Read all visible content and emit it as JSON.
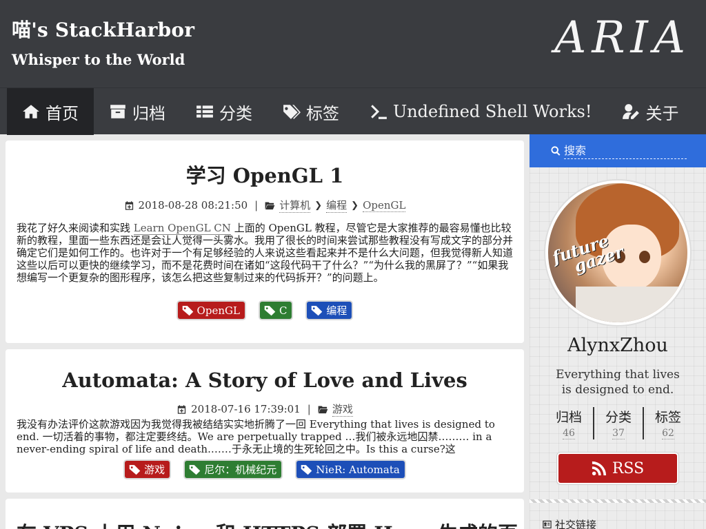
{
  "header": {
    "site_title": "喵's StackHarbor",
    "site_subtitle": "Whisper to the World",
    "logo_text": "ARIA"
  },
  "nav": {
    "items": [
      {
        "label": "首页",
        "icon": "home-icon"
      },
      {
        "label": "归档",
        "icon": "archive-icon"
      },
      {
        "label": "分类",
        "icon": "list-icon"
      },
      {
        "label": "标签",
        "icon": "tags-icon"
      },
      {
        "label": "Undefined Shell Works!",
        "icon": "terminal-icon"
      },
      {
        "label": "关于",
        "icon": "user-edit-icon"
      }
    ]
  },
  "posts": [
    {
      "title": "学习 OpenGL 1",
      "date": "2018-08-28 08:21:50",
      "categories": [
        "计算机",
        "编程",
        "OpenGL"
      ],
      "body_pre": "我花了好久来阅读和实践 ",
      "body_link": "Learn OpenGL CN",
      "body_post": " 上面的 OpenGL 教程，尽管它是大家推荐的最容易懂也比较新的教程，里面一些东西还是会让人觉得一头雾水。我用了很长的时间来尝试那些教程没有写成文字的部分并确定它们是如何工作的。也许对于一个有足够经验的人来说这些看起来并不是什么大问题，但我觉得新人知道这些以后可以更快的继续学习，而不是花费时间在诸如“这段代码干了什么？”“为什么我的黑屏了？”“如果我想编写一个更复杂的图形程序，该怎么把这些复制过来的代码拆开？”的问题上。",
      "tags": [
        {
          "label": "OpenGL",
          "color": "red"
        },
        {
          "label": "C",
          "color": "green"
        },
        {
          "label": "编程",
          "color": "blue"
        }
      ]
    },
    {
      "title": "Automata: A Story of Love and Lives",
      "date": "2018-07-16 17:39:01",
      "categories": [
        "游戏"
      ],
      "body": "我没有办法评价这款游戏因为我觉得我被结结实实地折腾了一回 Everything that lives is designed to end. 一切活着的事物，都注定要终结。We are perpetually trapped …我们被永远地囚禁……… in a never-ending spiral of life and death.……于永无止境的生死轮回之中。Is this a curse?这",
      "tags": [
        {
          "label": "游戏",
          "color": "red"
        },
        {
          "label": "尼尔：机械纪元",
          "color": "green"
        },
        {
          "label": "NieR: Automata",
          "color": "blue"
        }
      ]
    },
    {
      "title": "在 VPS 上用 Nginx 和 HTTPS 部署 Hexo 生成的页"
    }
  ],
  "sidebar": {
    "search_placeholder": "搜索",
    "avatar_text_1": "future",
    "avatar_text_2": "gazer",
    "author": "AlynxZhou",
    "motto": "Everything that lives is designed to end.",
    "stats": [
      {
        "label": "归档",
        "count": "46"
      },
      {
        "label": "分类",
        "count": "37"
      },
      {
        "label": "标签",
        "count": "62"
      }
    ],
    "rss_label": "RSS",
    "social_label": "社交链接"
  },
  "colors": {
    "header_bg": "#3a3c40",
    "search_bg": "#2f6ddc",
    "tag_red": "#b71c1c",
    "tag_green": "#2e7d32",
    "tag_blue": "#1d4fb8"
  }
}
